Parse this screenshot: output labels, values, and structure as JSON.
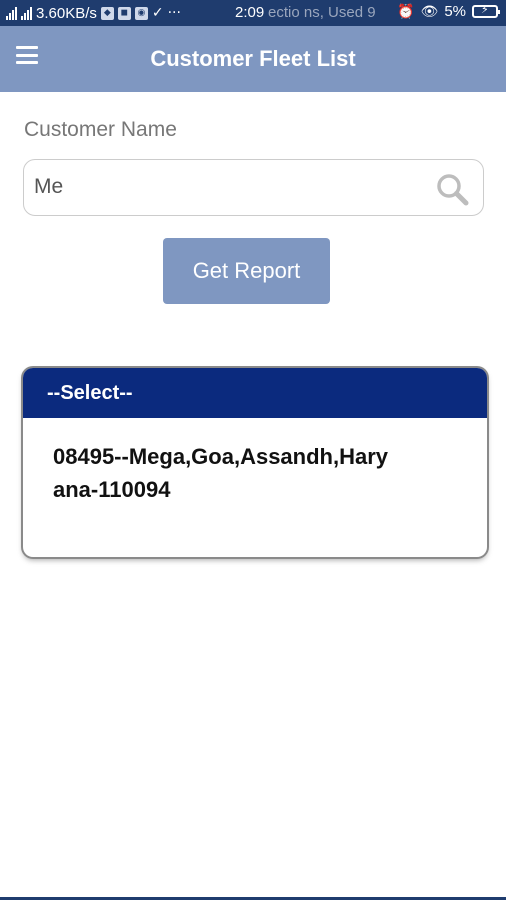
{
  "status_bar": {
    "speed": "3.60KB/s",
    "time": "2:09",
    "notification": "ectio ns, Used 9",
    "battery": "5%"
  },
  "header": {
    "title": "Customer Fleet List"
  },
  "form": {
    "customer_label": "Customer Name",
    "customer_value": "Me",
    "button_label": "Get Report"
  },
  "dropdown": {
    "header": "--Select--",
    "options": [
      "08495--Mega,Goa,Assandh,Haryana-110094"
    ]
  },
  "colors": {
    "status_bar": "#1f3c6e",
    "header": "#7f97c1",
    "dropdown_header": "#0b2a7e"
  },
  "icons": {
    "menu": "hamburger-menu-icon",
    "search": "search-icon"
  }
}
